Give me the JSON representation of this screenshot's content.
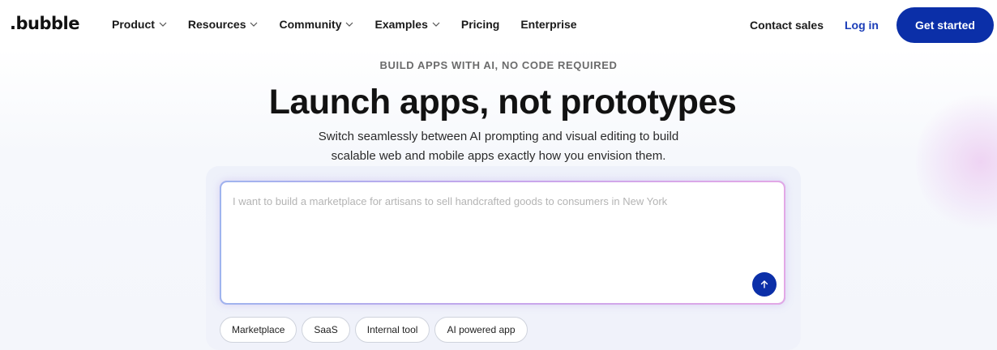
{
  "brand": {
    "logo_text": ".bubble"
  },
  "nav": {
    "items": [
      {
        "label": "Product",
        "has_dropdown": true
      },
      {
        "label": "Resources",
        "has_dropdown": true
      },
      {
        "label": "Community",
        "has_dropdown": true
      },
      {
        "label": "Examples",
        "has_dropdown": true
      },
      {
        "label": "Pricing",
        "has_dropdown": false
      },
      {
        "label": "Enterprise",
        "has_dropdown": false
      }
    ],
    "contact_label": "Contact sales",
    "login_label": "Log in",
    "cta_label": "Get started"
  },
  "hero": {
    "eyebrow": "BUILD APPS WITH AI, NO CODE REQUIRED",
    "headline": "Launch apps, not prototypes",
    "subline_1": "Switch seamlessly between AI prompting and visual editing to build",
    "subline_2": "scalable web and mobile apps exactly how you envision them."
  },
  "prompt": {
    "value": "",
    "placeholder": "I want to build a marketplace for artisans to sell handcrafted goods to consumers in New York",
    "send_icon": "arrow-up-icon"
  },
  "suggestions": [
    {
      "label": "Marketplace"
    },
    {
      "label": "SaaS"
    },
    {
      "label": "Internal tool"
    },
    {
      "label": "AI powered app"
    }
  ],
  "colors": {
    "primary": "#0b2fa8",
    "login_text": "#1b3db8",
    "prompt_border": "#b9a6e8",
    "panel_bg": "#eef1fa"
  }
}
